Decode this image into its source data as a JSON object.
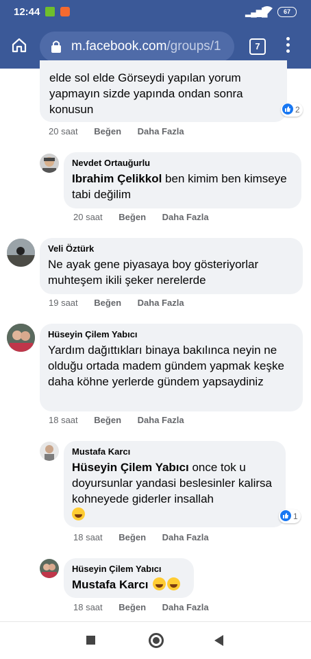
{
  "status_bar": {
    "time": "12:44",
    "battery": "67"
  },
  "browser": {
    "url_host": "m.facebook.com",
    "url_path": "/groups/1",
    "tab_count": "7"
  },
  "comments": [
    {
      "name": "",
      "lines": "elde sol elde Görseydi yapılan yorum yapmayın sizde yapında ondan sonra konusun",
      "time": "20 saat",
      "like": "Beğen",
      "more": "Daha Fazla",
      "reactions": "2"
    },
    {
      "name": "Nevdet Ortauğurlu",
      "mention": "Ibrahim Çelikkol",
      "text": " ben kimim ben kimseye tabi değilim",
      "time": "20 saat",
      "like": "Beğen",
      "more": "Daha Fazla"
    },
    {
      "name": "Veli Öztürk",
      "text": "Ne ayak gene piyasaya boy gösteriyorlar muhteşem ikili şeker nerelerde",
      "time": "19 saat",
      "like": "Beğen",
      "more": "Daha Fazla"
    },
    {
      "name": "Hüseyin Çilem Yabıcı",
      "text": "Yardım dağıttıkları binaya bakılınca neyin ne olduğu ortada madem gündem yapmak keşke daha köhne yerlerde gündem yapsaydiniz",
      "time": "18 saat",
      "like": "Beğen",
      "more": "Daha Fazla"
    },
    {
      "name": "Mustafa Karcı",
      "mention": "Hüseyin Çilem Yabıcı",
      "text": " once tok u doyursunlar yandasi beslesinler kalirsa kohneyede giderler insallah",
      "time": "18 saat",
      "like": "Beğen",
      "more": "Daha Fazla",
      "reactions": "1"
    },
    {
      "name": "Hüseyin Çilem Yabıcı",
      "mention": "Mustafa Karcı",
      "text": "",
      "time": "18 saat",
      "like": "Beğen",
      "more": "Daha Fazla"
    }
  ]
}
